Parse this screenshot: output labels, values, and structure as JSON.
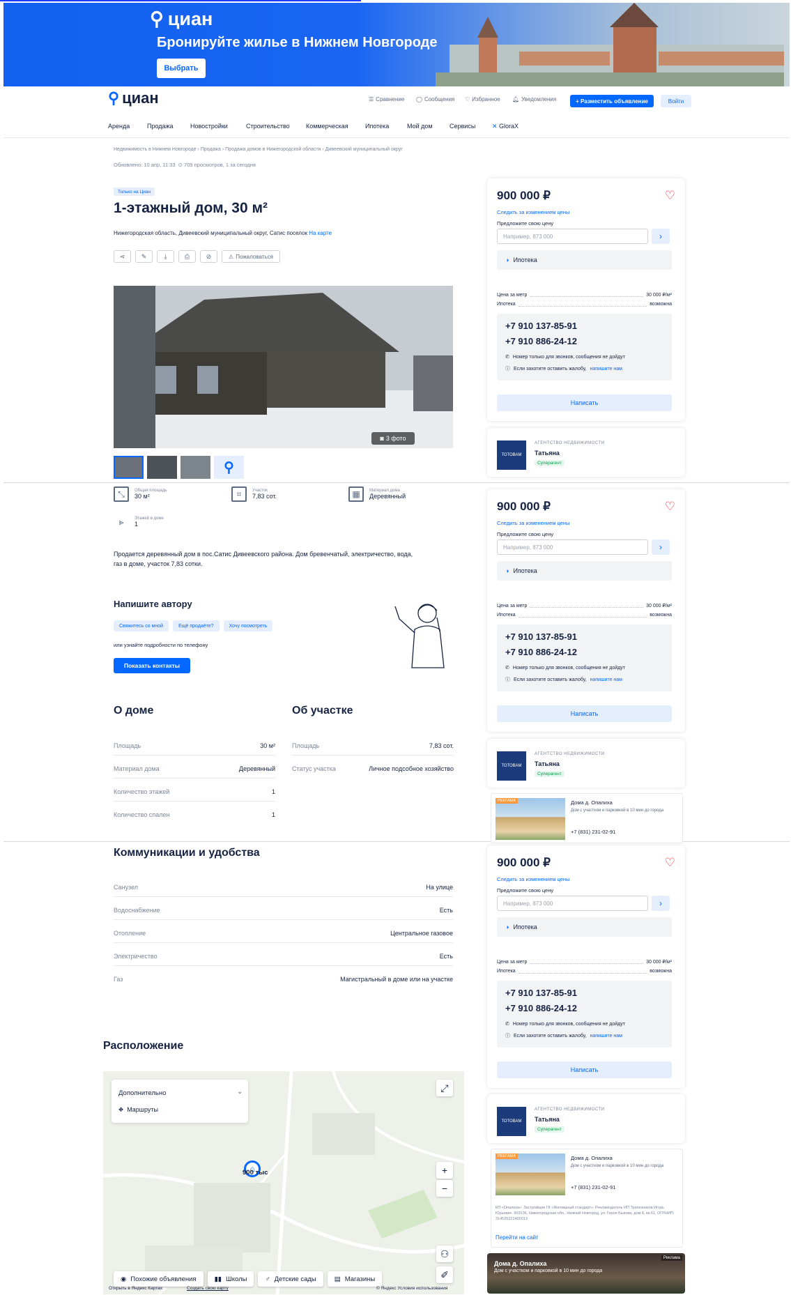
{
  "banner": {
    "logo": "циан",
    "title": "Бронируйте жилье в Нижнем Новгороде",
    "button": "Выбрать"
  },
  "header": {
    "logo": "циан",
    "nav": [
      "Сравнение",
      "Сообщения",
      "Избранное",
      "Уведомления"
    ],
    "post_button": "+ Разместить объявление",
    "login": "Войти",
    "menu": [
      "Аренда",
      "Продажа",
      "Новостройки",
      "Строительство",
      "Коммерческая",
      "Ипотека",
      "Мой дом",
      "Сервисы",
      "GloraX"
    ]
  },
  "breadcrumbs": "Недвижимость в Нижнем Новгороде  ›  Продажа  ›  Продажа домов в Нижегородской области  ›  Дивеевский муниципальный округ",
  "updated": "Обновлено: 10 апр, 11:33",
  "views": "709 просмотров, 1 за сегодня",
  "listing": {
    "badge": "Только на Циан",
    "title": "1-этажный дом, 30 м²",
    "address": "Нижегородская область, Дивеевский муниципальный округ, Сатис поселок",
    "map_link": "На карте",
    "complain": "Пожаловаться",
    "photo_count": "3 фото",
    "features": [
      {
        "label": "Общая площадь",
        "value": "30 м²"
      },
      {
        "label": "Участок",
        "value": "7,83 сот."
      },
      {
        "label": "Материал дома",
        "value": "Деревянный"
      },
      {
        "label": "Этажей в доме",
        "value": "1"
      }
    ],
    "description_1": "Продается деревянный дом в пос.Сатис Дивеевского района. Дом бревенчатый, электричество, вода,",
    "description_2": "газ в доме, участок 7,83 сотки."
  },
  "write_author": {
    "title": "Напишите автору",
    "chips": [
      "Свяжитесь со мной",
      "Ещё продаёте?",
      "Хочу посмотреть"
    ],
    "or_phone": "или узнайте подробности по телефону",
    "show_contacts": "Показать контакты"
  },
  "about_house": {
    "title": "О доме",
    "rows": [
      {
        "k": "Площадь",
        "v": "30 м²"
      },
      {
        "k": "Материал дома",
        "v": "Деревянный"
      },
      {
        "k": "Количество этажей",
        "v": "1"
      },
      {
        "k": "Количество спален",
        "v": "1"
      }
    ]
  },
  "about_plot": {
    "title": "Об участке",
    "rows": [
      {
        "k": "Площадь",
        "v": "7,83 сот."
      },
      {
        "k": "Статус участка",
        "v": "Личное подсобное хозяйство"
      }
    ]
  },
  "utilities": {
    "title": "Коммуникации и удобства",
    "rows": [
      {
        "k": "Санузел",
        "v": "На улице"
      },
      {
        "k": "Водоснабжение",
        "v": "Есть"
      },
      {
        "k": "Отопление",
        "v": "Центральное газовое"
      },
      {
        "k": "Электричество",
        "v": "Есть"
      },
      {
        "k": "Газ",
        "v": "Магистральный в доме или на участке"
      }
    ]
  },
  "location": {
    "title": "Расположение",
    "panel_title": "Дополнительно",
    "routes": "Маршруты",
    "pin_label": "900 тыс",
    "buttons": [
      "Похожие объявления",
      "Школы",
      "Детские сады",
      "Магазины"
    ],
    "attribution": "© Яндекс Условия использования",
    "open_link": "Открыть в Яндекс Картах",
    "fix_map": "Создать свою карту"
  },
  "sidebar": {
    "price": "900 000 ₽",
    "follow": "Следить за изменением цены",
    "offer_label": "Предложите свою цену",
    "offer_placeholder": "Например, 873 000",
    "mortgage": "Ипотека",
    "price_per_m_label": "Цена за метр",
    "price_per_m": "30 000 ₽/м²",
    "mortgage_label": "Ипотека",
    "mortgage_value": "возможна",
    "phone1": "+7 910 137-85-91",
    "phone2": "+7 910 886-24-12",
    "note1": "Номер только для звонков, сообщения не дойдут",
    "note2": "Если захотите оставить жалобу,",
    "note2_link": "напишите нам",
    "write": "Написать",
    "agency_type": "АГЕНТСТВО НЕДВИЖИМОСТИ",
    "agent": "Татьяна",
    "agent_badge": "Суперагент"
  },
  "ad": {
    "tag": "РЕКЛАМА",
    "title": "Дома д. Опалиха",
    "subtitle": "Дом с участком и парковкой в 10 мин до города",
    "phone": "+7 (831) 231-02-91",
    "legal": "КП «Опалиха». Застройщик ГК «Жилищный стандарт». Рекламодатель ИП Трапезников Игорь Юрьевич. 603136, Нижегородская обл., Нижний Новгород, ул. Героя Быкова, дом 8, кв.61, ОГРНИП: 314526221400013",
    "link": "Перейти на сайт",
    "bottom_title": "Дома д. Опалиха",
    "bottom_sub": "Дом с участком и парковкой в 10 мин до города",
    "bottom_tag": "Реклама"
  },
  "colors": {
    "accent": "#0468ff",
    "heart": "#ff1f34",
    "text": "#152242"
  }
}
